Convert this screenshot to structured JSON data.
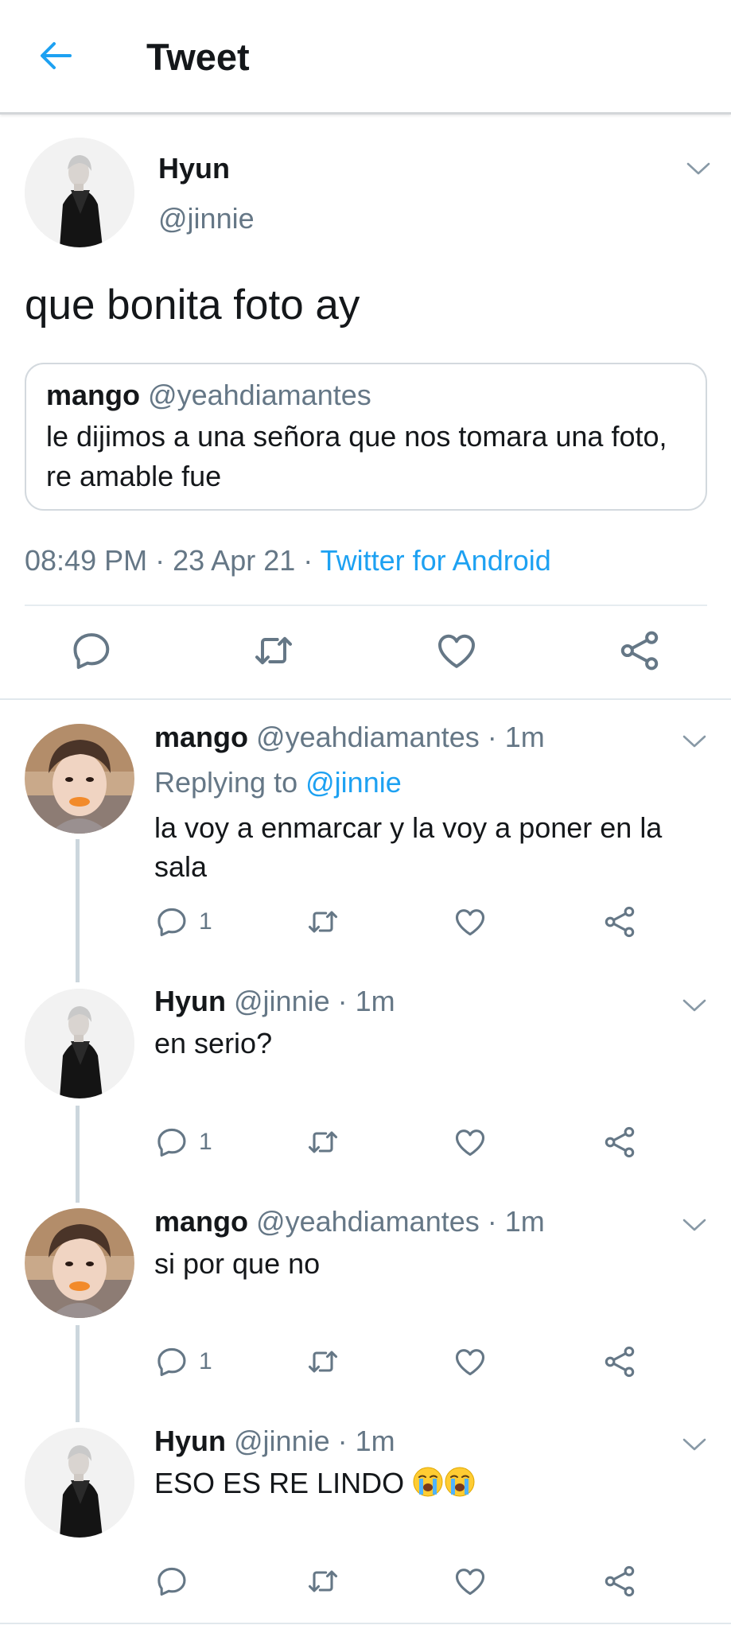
{
  "header": {
    "title": "Tweet",
    "back_icon": "arrow-left-icon"
  },
  "colors": {
    "accent": "#1da1f2",
    "muted": "#657786",
    "text": "#14171a",
    "border": "#e1e8ed"
  },
  "main_tweet": {
    "name": "Hyun",
    "handle": "@jinnie",
    "text": "que bonita foto ay",
    "quote": {
      "name": "mango",
      "handle": "@yeahdiamantes",
      "text": "le dijimos a una señora que nos tomara una foto, re amable fue"
    },
    "time": "08:49 PM",
    "date": "23 Apr 21",
    "sep": "·",
    "source": "Twitter for Android"
  },
  "replies": [
    {
      "name": "mango",
      "handle": "@yeahdiamantes",
      "dot": "·",
      "time": "1m",
      "replying_label": "Replying to",
      "replying_to": "@jinnie",
      "text": "la voy a enmarcar y la voy a poner en la sala",
      "reply_count": "1"
    },
    {
      "name": "Hyun",
      "handle": "@jinnie",
      "dot": "·",
      "time": "1m",
      "text": "en serio?",
      "reply_count": "1"
    },
    {
      "name": "mango",
      "handle": "@yeahdiamantes",
      "dot": "·",
      "time": "1m",
      "text": "si por que no",
      "reply_count": "1"
    },
    {
      "name": "Hyun",
      "handle": "@jinnie",
      "dot": "·",
      "time": "1m",
      "text": "ESO ES RE LINDO",
      "emojis": "crying-face-emoji x2",
      "reply_count": ""
    }
  ]
}
